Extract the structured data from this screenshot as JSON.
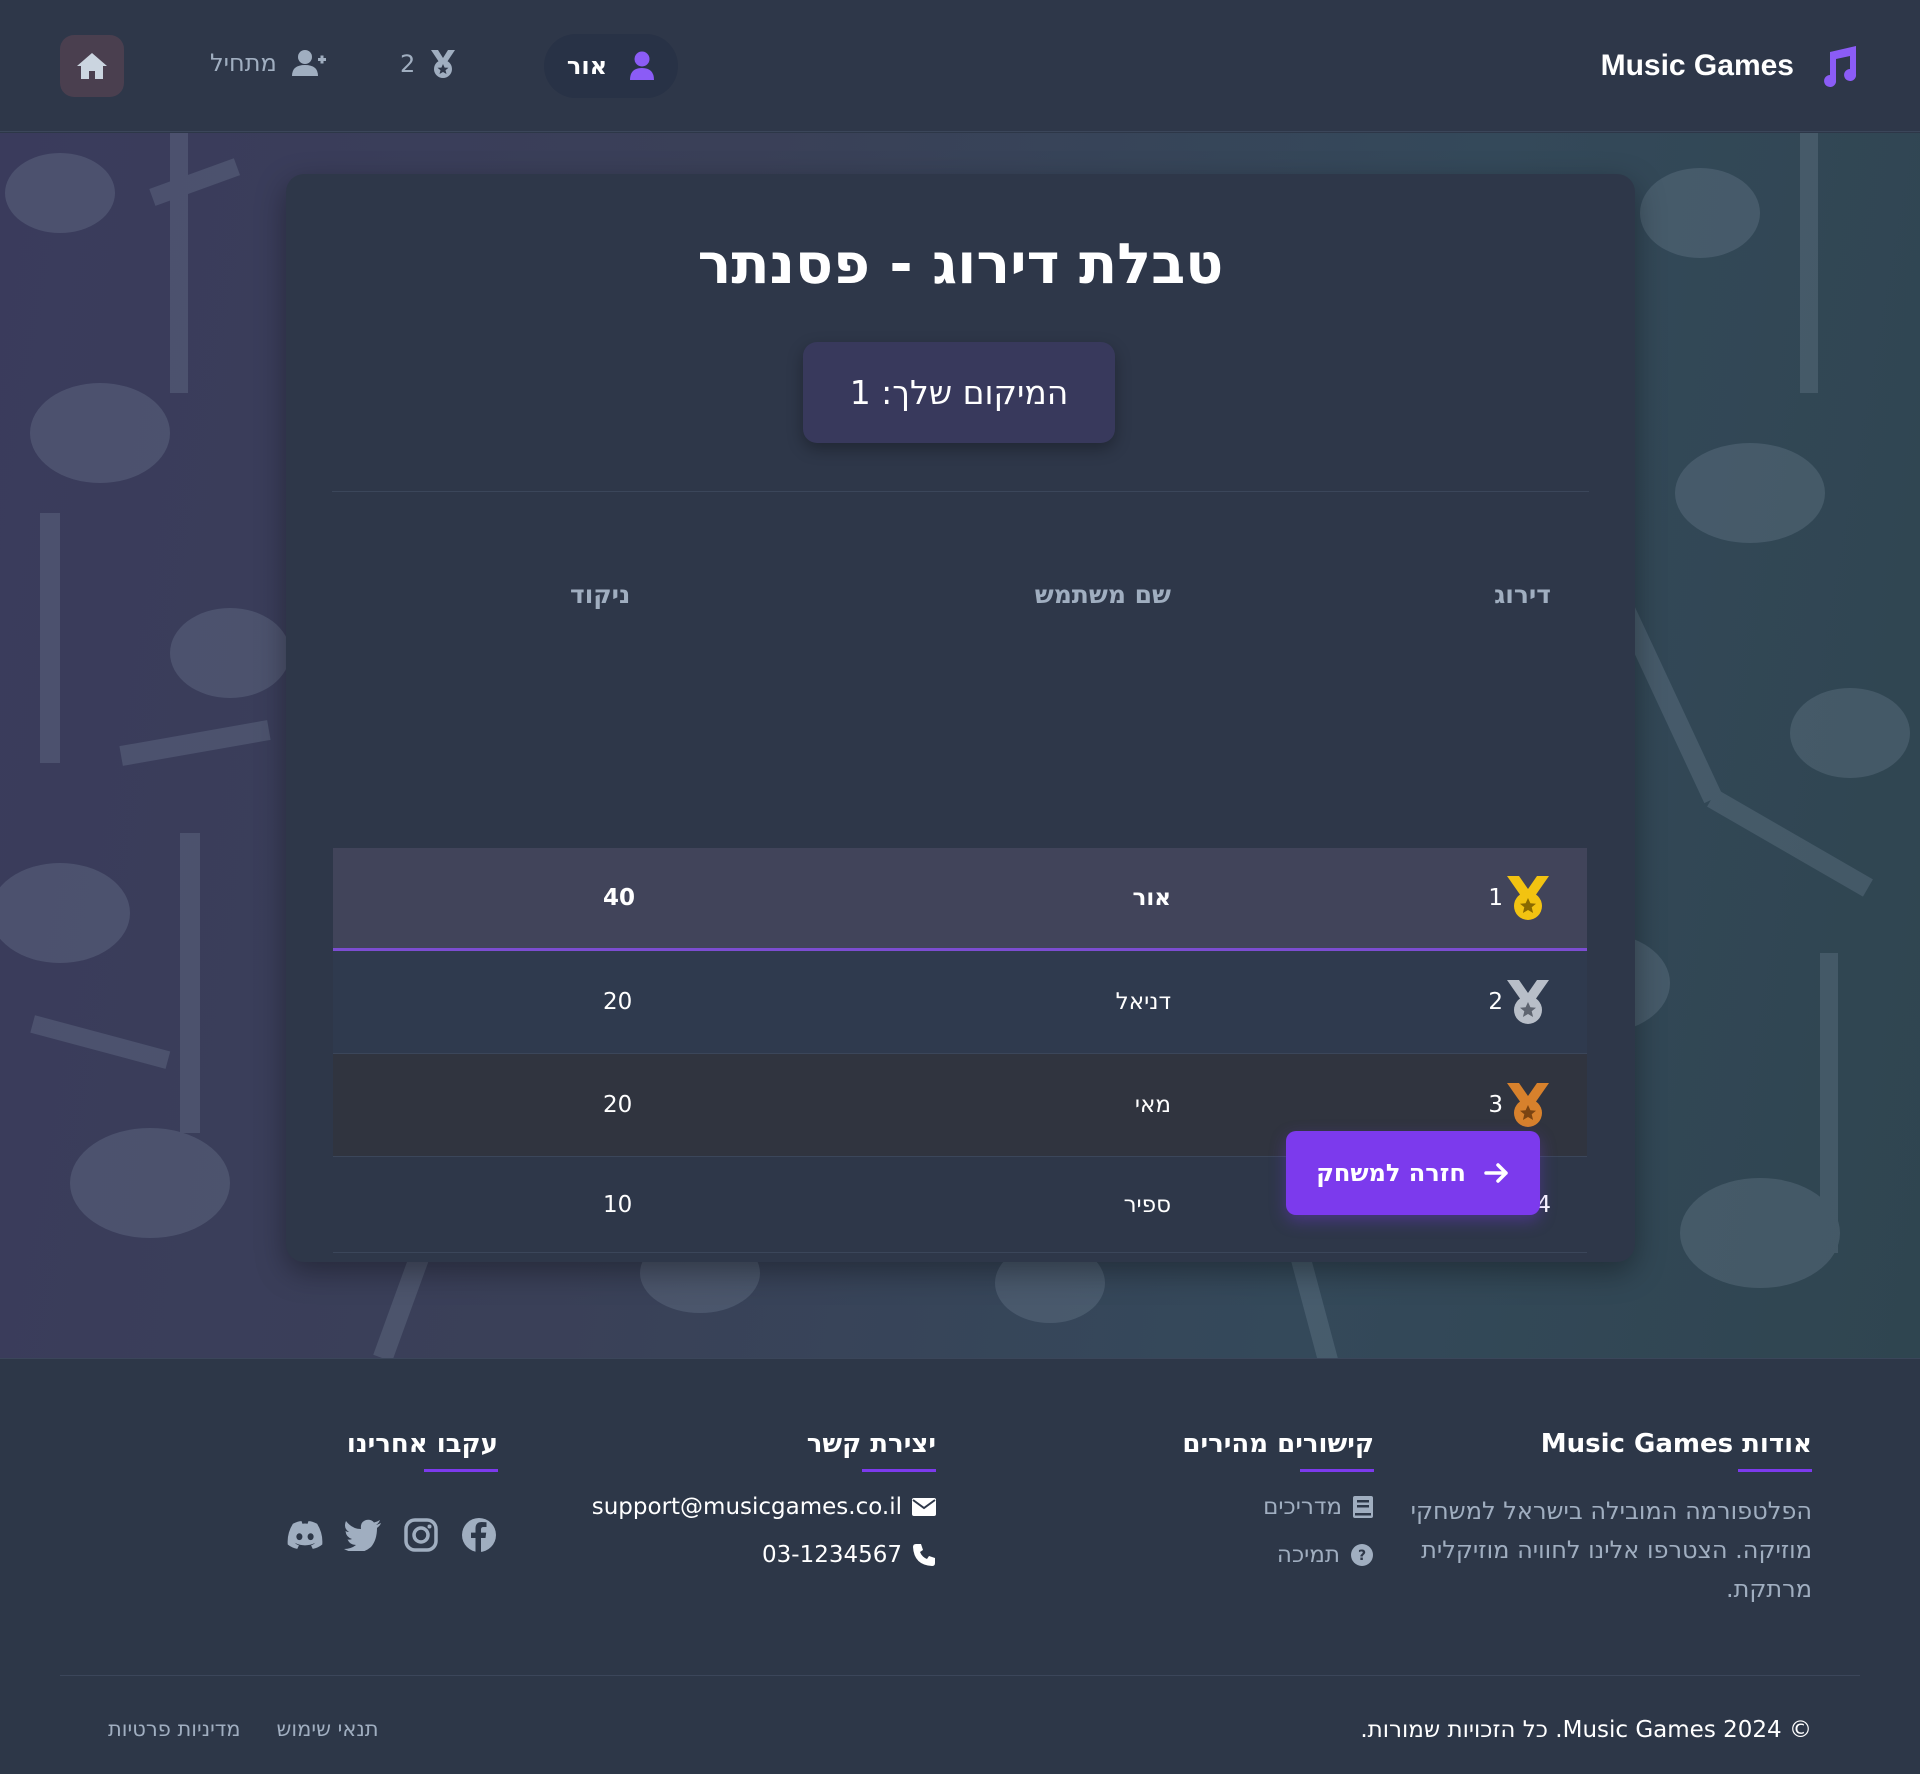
{
  "header": {
    "brand": "Music Games",
    "user_name": "אור",
    "medal_count": "2",
    "level": "מתחיל"
  },
  "card": {
    "title": "טבלת דירוג - פסנתר",
    "my_rank": "המיקום שלך: 1",
    "columns": {
      "rank": "דירוג",
      "name": "שם משתמש",
      "score": "ניקוד"
    },
    "rows": [
      {
        "rank": "1",
        "name": "אור",
        "score": "40",
        "medal": "gold"
      },
      {
        "rank": "2",
        "name": "דניאל",
        "score": "20",
        "medal": "silver"
      },
      {
        "rank": "3",
        "name": "מאי",
        "score": "20",
        "medal": "bronze"
      },
      {
        "rank": "4",
        "name": "ספיר",
        "score": "10",
        "medal": ""
      }
    ],
    "back_button": "חזרה למשחק"
  },
  "footer": {
    "about_title": "אודות Music Games",
    "about_text": "הפלטפורמה המובילה בישראל למשחקי מוזיקה. הצטרפו אלינו לחוויה מוזיקלית מרתקת.",
    "links_title": "קישורים מהירים",
    "link_guides": "מדריכים",
    "link_support": "תמיכה",
    "contact_title": "יצירת קשר",
    "email": "support@musicgames.co.il",
    "phone": "03-1234567",
    "follow_title": "עקבו אחרינו",
    "copyright": "© 2024 Music Games. כל הזכויות שמורות.",
    "terms": "תנאי שימוש",
    "privacy": "מדיניות פרטיות"
  },
  "colors": {
    "accent": "#7c3aed",
    "gold": "#f2c311",
    "silver": "#b8bec8",
    "bronze": "#d7812c"
  },
  "icons": [
    "music-note-icon",
    "user-icon",
    "medal-icon",
    "user-plus-icon",
    "home-icon",
    "arrow-right-icon",
    "book-icon",
    "question-circle-icon",
    "envelope-icon",
    "phone-icon",
    "facebook-icon",
    "instagram-icon",
    "twitter-icon",
    "discord-icon"
  ]
}
